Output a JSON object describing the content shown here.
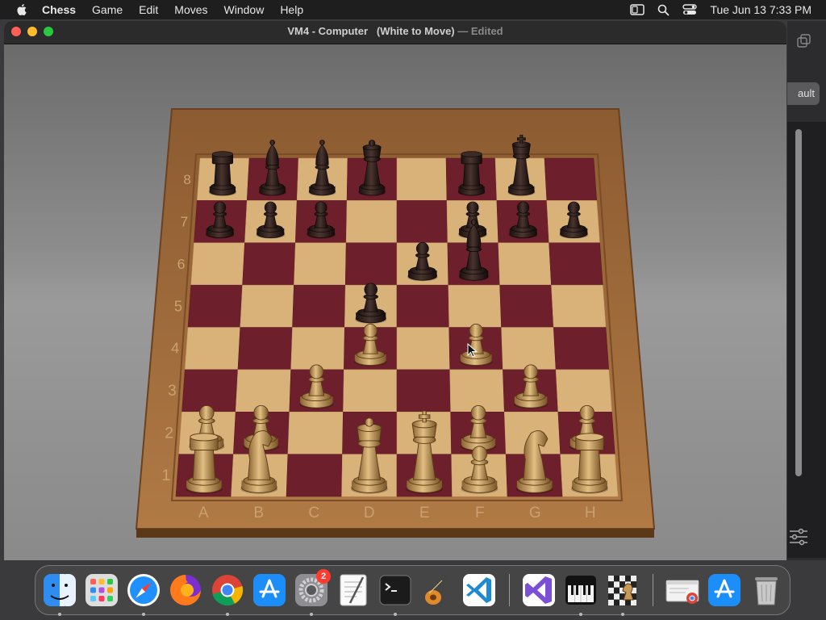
{
  "menubar": {
    "app_name": "Chess",
    "items": [
      "Game",
      "Edit",
      "Moves",
      "Window",
      "Help"
    ],
    "clock": "Tue Jun 13  7:33 PM",
    "icons": [
      "display-icon",
      "search-icon",
      "control-center-icon"
    ]
  },
  "window": {
    "title": "VM4 - Computer",
    "subtitle": "(White to Move)",
    "separator": "—",
    "edited": "Edited"
  },
  "board": {
    "files": [
      "A",
      "B",
      "C",
      "D",
      "E",
      "F",
      "G",
      "H"
    ],
    "ranks": [
      "8",
      "7",
      "6",
      "5",
      "4",
      "3",
      "2",
      "1"
    ],
    "pieces": [
      {
        "color": "black",
        "type": "rook",
        "square": "a8"
      },
      {
        "color": "black",
        "type": "bishop",
        "square": "b8"
      },
      {
        "color": "black",
        "type": "bishop",
        "square": "c8"
      },
      {
        "color": "black",
        "type": "queen",
        "square": "d8"
      },
      {
        "color": "black",
        "type": "rook",
        "square": "f8"
      },
      {
        "color": "black",
        "type": "king",
        "square": "g8"
      },
      {
        "color": "black",
        "type": "pawn",
        "square": "a7"
      },
      {
        "color": "black",
        "type": "pawn",
        "square": "b7"
      },
      {
        "color": "black",
        "type": "pawn",
        "square": "c7"
      },
      {
        "color": "black",
        "type": "pawn",
        "square": "f7"
      },
      {
        "color": "black",
        "type": "pawn",
        "square": "g7"
      },
      {
        "color": "black",
        "type": "pawn",
        "square": "h7"
      },
      {
        "color": "black",
        "type": "pawn",
        "square": "e6"
      },
      {
        "color": "black",
        "type": "bishop",
        "square": "f6"
      },
      {
        "color": "black",
        "type": "pawn",
        "square": "d5"
      },
      {
        "color": "white",
        "type": "pawn",
        "square": "d4"
      },
      {
        "color": "white",
        "type": "pawn",
        "square": "f4"
      },
      {
        "color": "white",
        "type": "pawn",
        "square": "c3"
      },
      {
        "color": "white",
        "type": "pawn",
        "square": "g3"
      },
      {
        "color": "white",
        "type": "pawn",
        "square": "a2"
      },
      {
        "color": "white",
        "type": "pawn",
        "square": "b2"
      },
      {
        "color": "white",
        "type": "pawn",
        "square": "f2"
      },
      {
        "color": "white",
        "type": "pawn",
        "square": "h2"
      },
      {
        "color": "white",
        "type": "rook",
        "square": "a1"
      },
      {
        "color": "white",
        "type": "knight",
        "square": "b1"
      },
      {
        "color": "white",
        "type": "queen",
        "square": "d1"
      },
      {
        "color": "white",
        "type": "king",
        "square": "e1"
      },
      {
        "color": "white",
        "type": "pawn",
        "square": "f1"
      },
      {
        "color": "white",
        "type": "knight",
        "square": "g1"
      },
      {
        "color": "white",
        "type": "rook",
        "square": "h1"
      }
    ],
    "colors": {
      "dark_square": "#6e1f2c",
      "light_square": "#d9b27a",
      "frame": "#9b6a3c",
      "black_piece": "#2a1c1a",
      "white_piece": "#c79a5a"
    }
  },
  "side_window": {
    "button_label": "ault"
  },
  "dock": {
    "apps": [
      {
        "name": "finder",
        "running": true
      },
      {
        "name": "launchpad",
        "running": false
      },
      {
        "name": "safari",
        "running": true
      },
      {
        "name": "firefox",
        "running": false
      },
      {
        "name": "chrome",
        "running": true
      },
      {
        "name": "app-store",
        "running": false
      },
      {
        "name": "system-settings",
        "running": true,
        "badge": "2"
      },
      {
        "name": "textedit",
        "running": false
      },
      {
        "name": "terminal",
        "running": true
      },
      {
        "name": "garageband",
        "running": false
      },
      {
        "name": "vscode",
        "running": false
      },
      {
        "name": "visual-studio",
        "running": false
      },
      {
        "name": "piano",
        "running": true
      },
      {
        "name": "chess",
        "running": true
      },
      {
        "name": "window-thumbnail",
        "running": false
      },
      {
        "name": "app-store-2",
        "running": false
      },
      {
        "name": "trash",
        "running": false
      }
    ]
  }
}
